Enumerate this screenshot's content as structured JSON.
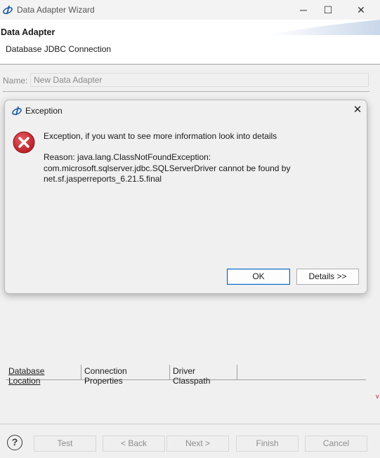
{
  "window": {
    "title": "Data Adapter Wizard",
    "minimize_glyph": "─",
    "maximize_glyph": "☐",
    "close_glyph": "✕"
  },
  "header": {
    "title": "Data Adapter",
    "subtitle": "Database JDBC Connection"
  },
  "form": {
    "name_label": "Name:",
    "name_value": "New Data Adapter"
  },
  "tabs": [
    {
      "label": "Database Location"
    },
    {
      "label": "Connection Properties"
    },
    {
      "label": "Driver Classpath"
    }
  ],
  "footer": {
    "help_glyph": "?",
    "buttons": [
      {
        "label": "Test"
      },
      {
        "label": "< Back"
      },
      {
        "label": "Next >"
      },
      {
        "label": "Finish"
      },
      {
        "label": "Cancel"
      }
    ]
  },
  "dialog": {
    "title": "Exception",
    "close_glyph": "✕",
    "message": "Exception, if you want to see more information look into details",
    "reason": "Reason: java.lang.ClassNotFoundException:\ncom.microsoft.sqlserver.jdbc.SQLServerDriver cannot be found by\nnet.sf.jasperreports_6.21.5.final",
    "ok_label": "OK",
    "details_label": "Details >>"
  },
  "icons": {
    "app": "jaspersoft-icon",
    "error": "error-icon",
    "help": "help-icon"
  },
  "colors": {
    "error_red": "#cc2b34",
    "ok_border": "#0a64c8"
  }
}
